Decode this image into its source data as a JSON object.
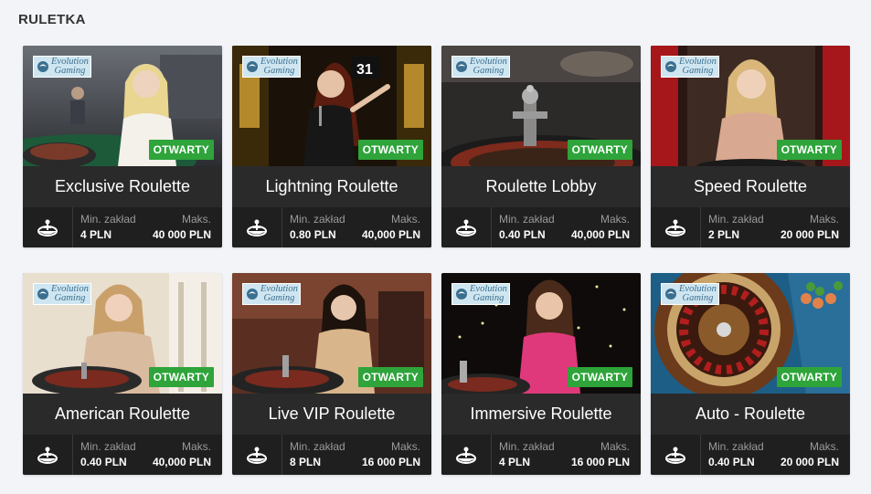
{
  "section": {
    "title": "RULETKA"
  },
  "provider_label_line1": "Evolution",
  "provider_label_line2": "Gaming",
  "status_color": "#2ea43a",
  "footer_icon": "roulette-wheel-icon",
  "games": [
    {
      "name": "Exclusive Roulette",
      "status": "OTWARTY",
      "min_label": "Min. zakład",
      "max_label": "Maks.",
      "min": "4 PLN",
      "max": "40 000 PLN"
    },
    {
      "name": "Lightning Roulette",
      "status": "OTWARTY",
      "min_label": "Min. zakład",
      "max_label": "Maks.",
      "min": "0.80 PLN",
      "max": "40,000 PLN"
    },
    {
      "name": "Roulette Lobby",
      "status": "OTWARTY",
      "min_label": "Min. zakład",
      "max_label": "Maks.",
      "min": "0.40 PLN",
      "max": "40,000 PLN"
    },
    {
      "name": "Speed Roulette",
      "status": "OTWARTY",
      "min_label": "Min. zakład",
      "max_label": "Maks.",
      "min": "2 PLN",
      "max": "20 000 PLN"
    },
    {
      "name": "American Roulette",
      "status": "OTWARTY",
      "min_label": "Min. zakład",
      "max_label": "Maks.",
      "min": "0.40 PLN",
      "max": "40,000 PLN"
    },
    {
      "name": "Live VIP Roulette",
      "status": "OTWARTY",
      "min_label": "Min. zakład",
      "max_label": "Maks.",
      "min": "8 PLN",
      "max": "16 000 PLN"
    },
    {
      "name": "Immersive Roulette",
      "status": "OTWARTY",
      "min_label": "Min. zakład",
      "max_label": "Maks.",
      "min": "4 PLN",
      "max": "16 000 PLN"
    },
    {
      "name": "Auto - Roulette",
      "status": "OTWARTY",
      "min_label": "Min. zakład",
      "max_label": "Maks.",
      "min": "0.40 PLN",
      "max": "20 000 PLN"
    }
  ]
}
